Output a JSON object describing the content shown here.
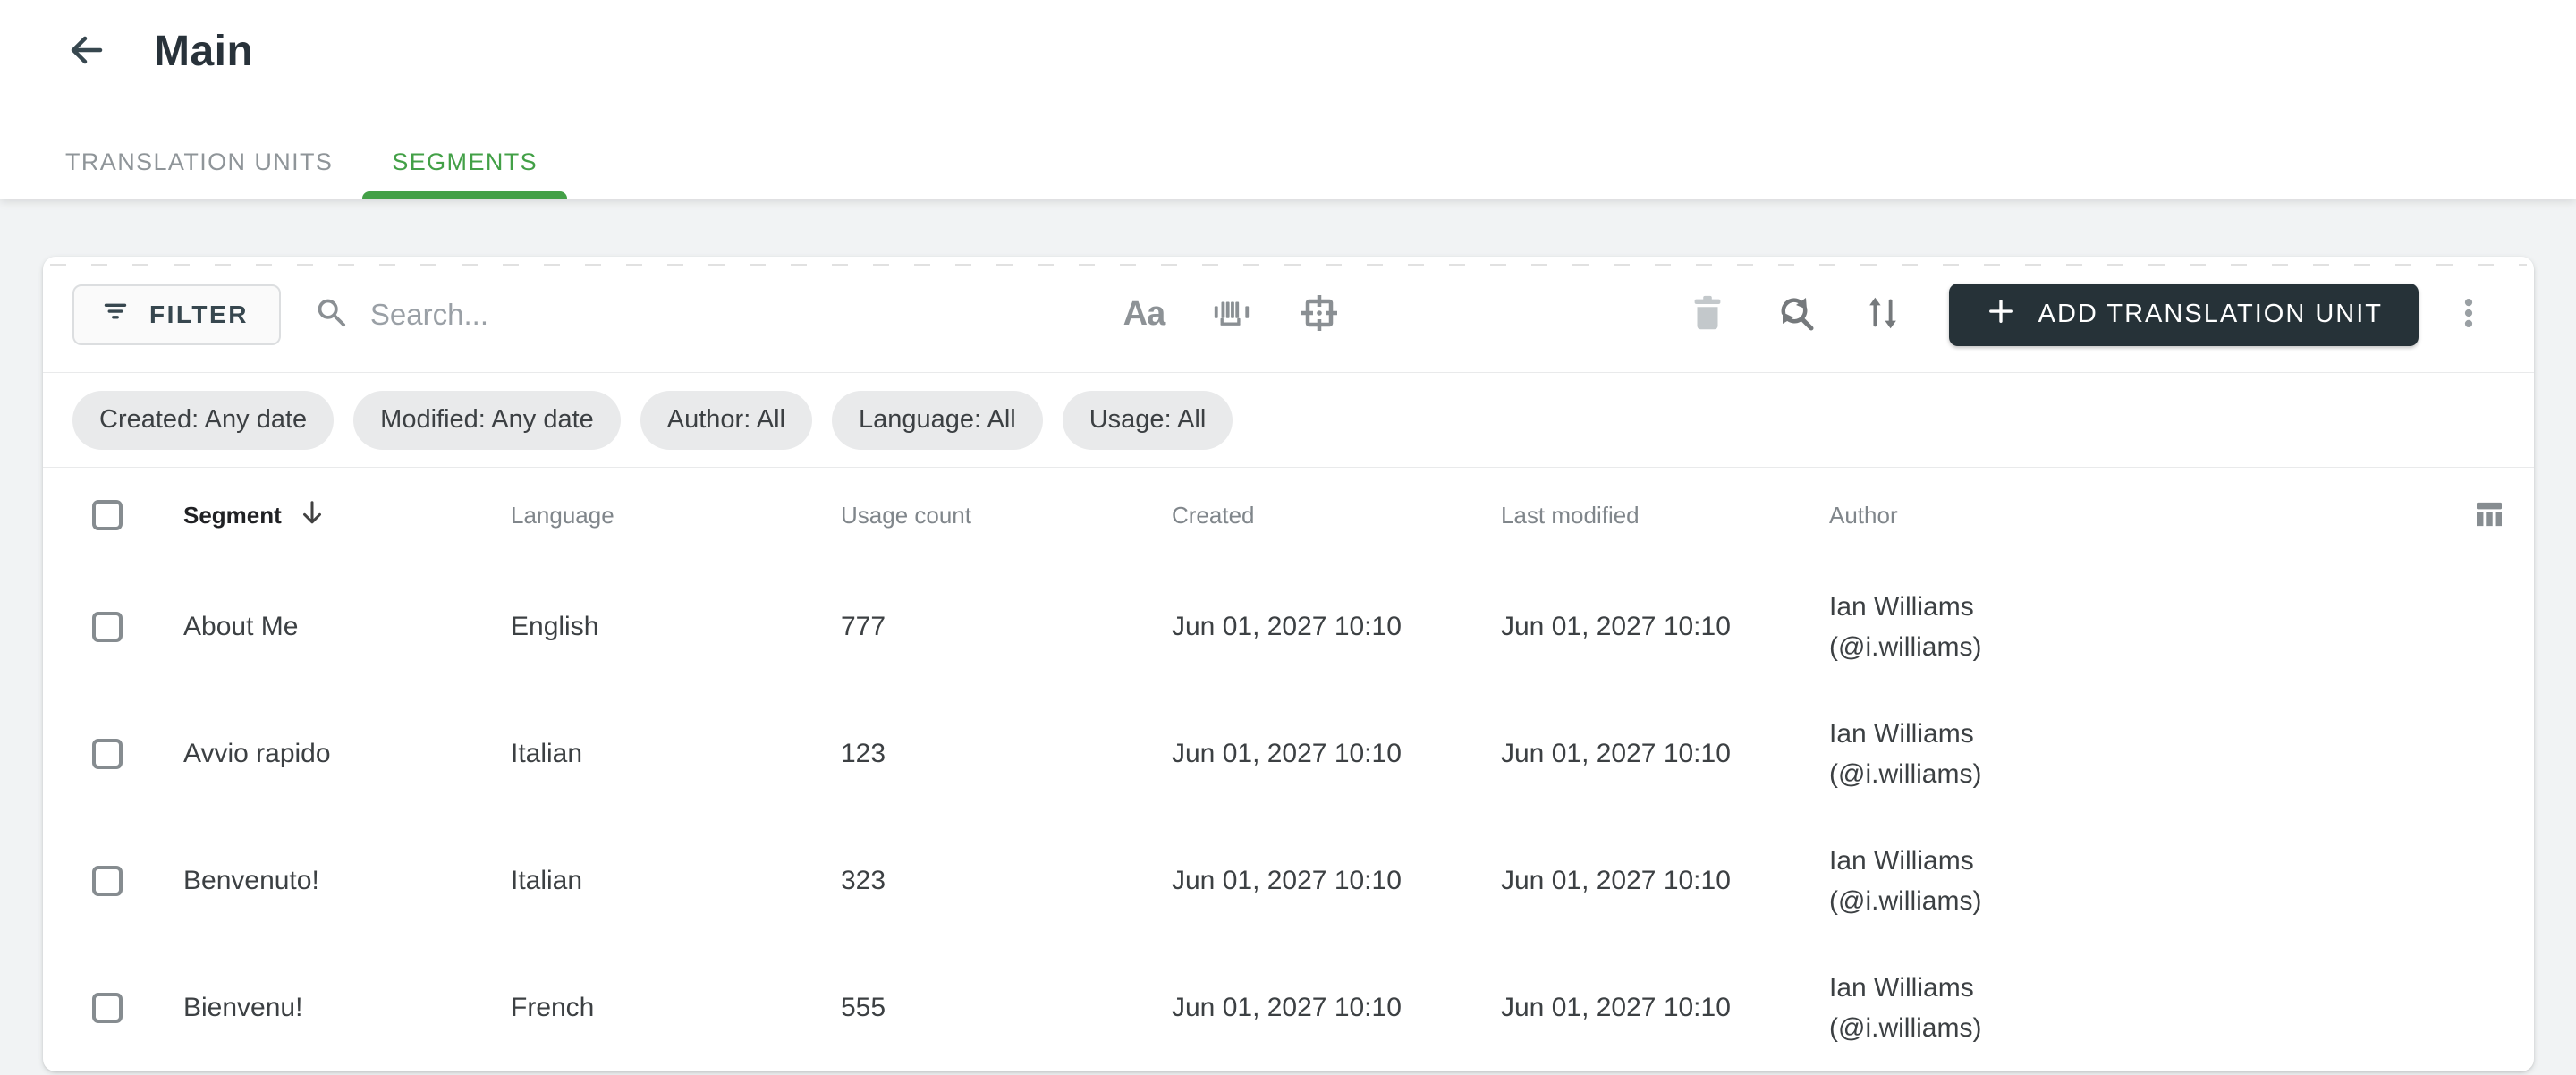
{
  "header": {
    "title": "Main"
  },
  "tabs": [
    {
      "label": "TRANSLATION UNITS",
      "active": false
    },
    {
      "label": "SEGMENTS",
      "active": true
    }
  ],
  "toolbar": {
    "filter_label": "FILTER",
    "search_placeholder": "Search...",
    "match_case_label": "Aa",
    "add_label": "ADD TRANSLATION UNIT"
  },
  "filter_chips": [
    {
      "label": "Created: Any date"
    },
    {
      "label": "Modified: Any date"
    },
    {
      "label": "Author: All"
    },
    {
      "label": "Language: All"
    },
    {
      "label": "Usage: All"
    }
  ],
  "table": {
    "columns": [
      {
        "label": "Segment"
      },
      {
        "label": "Language"
      },
      {
        "label": "Usage count"
      },
      {
        "label": "Created"
      },
      {
        "label": "Last modified"
      },
      {
        "label": "Author"
      }
    ],
    "sort": {
      "column": "Segment",
      "direction": "descending"
    },
    "rows": [
      {
        "segment": "About Me",
        "language": "English",
        "usage_count": "777",
        "created": "Jun 01, 2027 10:10",
        "last_modified": "Jun 01, 2027 10:10",
        "author_name": "Ian Williams",
        "author_handle": "(@i.williams)"
      },
      {
        "segment": "Avvio rapido",
        "language": "Italian",
        "usage_count": "123",
        "created": "Jun 01, 2027 10:10",
        "last_modified": "Jun 01, 2027 10:10",
        "author_name": "Ian Williams",
        "author_handle": "(@i.williams)"
      },
      {
        "segment": "Benvenuto!",
        "language": "Italian",
        "usage_count": "323",
        "created": "Jun 01, 2027 10:10",
        "last_modified": "Jun 01, 2027 10:10",
        "author_name": "Ian Williams",
        "author_handle": "(@i.williams)"
      },
      {
        "segment": "Bienvenu!",
        "language": "French",
        "usage_count": "555",
        "created": "Jun 01, 2027 10:10",
        "last_modified": "Jun 01, 2027 10:10",
        "author_name": "Ian Williams",
        "author_handle": "(@i.williams)"
      }
    ]
  },
  "icons": {
    "back": "arrow-left-icon",
    "filter": "filter-icon",
    "search": "search-icon",
    "match_case": "match-case-icon",
    "whole_word": "barcode-whole-word-icon",
    "regex": "crop-target-icon",
    "delete": "trash-icon",
    "refresh_search": "refresh-search-icon",
    "sort": "sort-arrows-icon",
    "add": "plus-icon",
    "more": "kebab-menu-icon",
    "columns": "column-settings-icon",
    "sort_descending": "arrow-down-icon"
  },
  "colors": {
    "accent_green": "#43a047",
    "primary_dark": "#263238",
    "page_background": "#f1f3f4",
    "chip_background": "#e9eaeb"
  }
}
